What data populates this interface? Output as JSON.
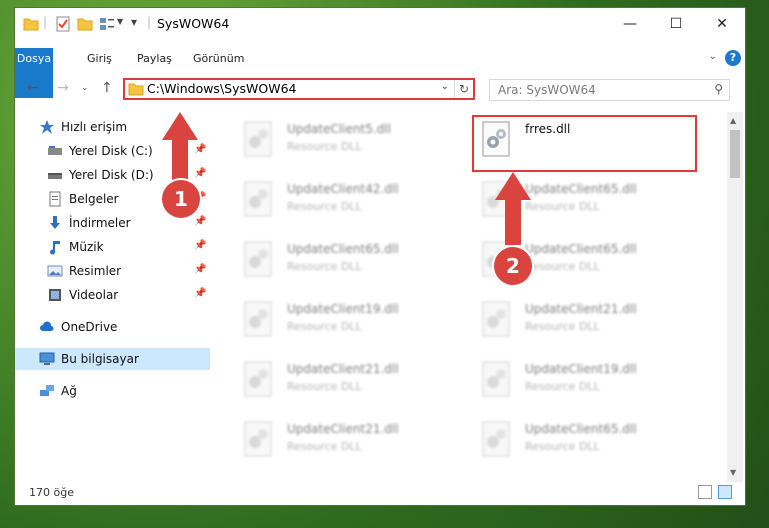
{
  "window": {
    "title": "SysWOW64",
    "controls": {
      "minimize": "—",
      "maximize": "☐",
      "close": "✕"
    }
  },
  "ribbon": {
    "tabs": [
      "Dosya",
      "Giriş",
      "Paylaş",
      "Görünüm"
    ],
    "help": "?"
  },
  "address": {
    "path": "C:\\Windows\\SysWOW64",
    "search_placeholder": "Ara: SysWOW64"
  },
  "nav": {
    "items": [
      {
        "label": "Hızlı erişim",
        "icon": "star-icon"
      },
      {
        "label": "Yerel Disk (C:)",
        "icon": "drive-icon",
        "pinned": true
      },
      {
        "label": "Yerel Disk (D:)",
        "icon": "drive-icon",
        "pinned": true
      },
      {
        "label": "Belgeler",
        "icon": "documents-icon",
        "pinned": true
      },
      {
        "label": "İndirmeler",
        "icon": "download-icon",
        "pinned": true
      },
      {
        "label": "Müzik",
        "icon": "music-icon",
        "pinned": true
      },
      {
        "label": "Resimler",
        "icon": "pictures-icon",
        "pinned": true
      },
      {
        "label": "Videolar",
        "icon": "videos-icon",
        "pinned": true
      },
      {
        "label": "OneDrive",
        "icon": "cloud-icon"
      },
      {
        "label": "Bu bilgisayar",
        "icon": "computer-icon",
        "selected": true
      },
      {
        "label": "Ağ",
        "icon": "network-icon"
      }
    ]
  },
  "files": [
    {
      "name": "UpdateClient5.dll",
      "type": "Resource DLL"
    },
    {
      "name": "frres.dll",
      "type": ""
    },
    {
      "name": "UpdateClient42.dll",
      "type": "Resource DLL"
    },
    {
      "name": "UpdateClient65.dll",
      "type": "Resource DLL"
    },
    {
      "name": "UpdateClient65.dll",
      "type": "Resource DLL"
    },
    {
      "name": "UpdateClient65.dll",
      "type": "Resource DLL"
    },
    {
      "name": "UpdateClient19.dll",
      "type": "Resource DLL"
    },
    {
      "name": "UpdateClient21.dll",
      "type": "Resource DLL"
    },
    {
      "name": "UpdateClient21.dll",
      "type": "Resource DLL"
    },
    {
      "name": "UpdateClient19.dll",
      "type": "Resource DLL"
    },
    {
      "name": "UpdateClient21.dll",
      "type": "Resource DLL"
    },
    {
      "name": "UpdateClient65.dll",
      "type": "Resource DLL"
    }
  ],
  "status": {
    "count": "170 öğe"
  },
  "annotations": {
    "step1": "1",
    "step2": "2"
  },
  "colors": {
    "accent": "#1979ca",
    "highlight": "#e03a3a",
    "selection": "#cce8ff"
  }
}
